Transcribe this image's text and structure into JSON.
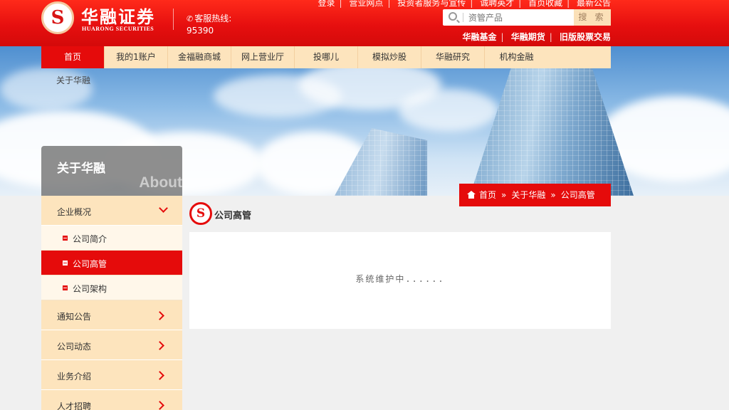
{
  "header": {
    "logo_char": "S",
    "brand_cn": "华融证券",
    "brand_en": "HUARONG SECURITIES",
    "hotline_label": "客服热线:",
    "hotline_number": "95390",
    "top_links": [
      "登录",
      "营业网点",
      "投资者服务与宣传",
      "诚聘英才",
      "首页收藏",
      "最新公告"
    ],
    "search": {
      "placeholder": "资管产品",
      "button": "搜 索"
    },
    "sub_links": [
      "华融基金",
      "华融期货",
      "旧版股票交易"
    ]
  },
  "nav": {
    "items": [
      "首页",
      "我的1账户",
      "金福融商城",
      "网上营业厅",
      "投哪儿",
      "模拟炒股",
      "华融研究",
      "机构金融"
    ],
    "active_index": 0
  },
  "crumb_about": "关于华融",
  "sidebar": {
    "title": "关于华融",
    "title_en": "About",
    "groups": [
      {
        "label": "企业概况",
        "expanded": true,
        "children": [
          "公司简介",
          "公司高管",
          "公司架构"
        ],
        "active_child": 1
      },
      {
        "label": "通知公告"
      },
      {
        "label": "公司动态"
      },
      {
        "label": "业务介绍"
      },
      {
        "label": "人才招聘"
      }
    ]
  },
  "location": {
    "home": "首页",
    "arrow": "»",
    "level1": "关于华融",
    "level2": "公司高管"
  },
  "content": {
    "title": "公司高管",
    "message": "系统维护中......"
  },
  "colors": {
    "brand_red": "#e50b0b",
    "nav_bg": "#fde4bd"
  }
}
